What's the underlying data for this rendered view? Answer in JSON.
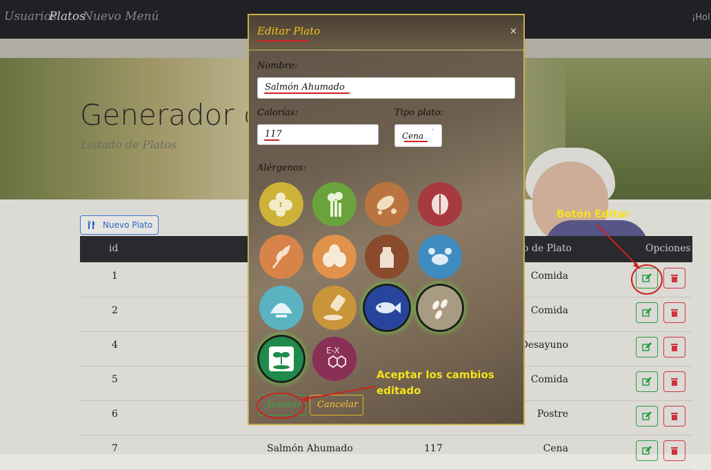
{
  "navbar": {
    "items": [
      "Usuarios",
      "Platos",
      "Nuevo Menú"
    ],
    "active": "Platos",
    "greeting": "¡Hol"
  },
  "hero": {
    "title": "Generador de",
    "subtitle": "Listado de Platos"
  },
  "toolbar": {
    "new_dish_label": "Nuevo Plato"
  },
  "table": {
    "headers": {
      "id": "id",
      "tipo": "o de Plato",
      "opciones": "Opciones"
    },
    "rows": [
      {
        "id": "1",
        "tipo": "Comida"
      },
      {
        "id": "2",
        "tipo": "Comida"
      },
      {
        "id": "4",
        "tipo": "Desayuno"
      },
      {
        "id": "5",
        "tipo": "Comida"
      },
      {
        "id": "6",
        "tipo": "Postre"
      },
      {
        "id": "7",
        "nombre": "Salmón Ahumado",
        "calorias": "117",
        "tipo": "Cena"
      }
    ]
  },
  "modal": {
    "title": "Editar Plato",
    "close": "×",
    "nombre_label": "Nombre:",
    "nombre_value": "Salmón Ahumado",
    "calorias_label": "Calorías:",
    "calorias_value": "117",
    "tipo_label": "Tipo plato:",
    "tipo_value": "Cena",
    "alergenos_label": "Alérgenos:",
    "allergens": [
      {
        "icon": "mustard-icon",
        "color": "#cdb23a",
        "selected": false
      },
      {
        "icon": "celery-icon",
        "color": "#6aa33c",
        "selected": false
      },
      {
        "icon": "peanut-icon",
        "color": "#b9743f",
        "selected": false
      },
      {
        "icon": "nuts-icon",
        "color": "#a73a3e",
        "selected": false
      },
      {
        "icon": "gluten-icon",
        "color": "#d8834a",
        "selected": false
      },
      {
        "icon": "eggs-icon",
        "color": "#e0914a",
        "selected": false
      },
      {
        "icon": "milk-icon",
        "color": "#8a4a2c",
        "selected": false
      },
      {
        "icon": "crustaceans-icon",
        "color": "#3f8cc0",
        "selected": false
      },
      {
        "icon": "molluscs-icon",
        "color": "#5bb3c2",
        "selected": false
      },
      {
        "icon": "soy-sauce-icon",
        "color": "#c9953a",
        "selected": false
      },
      {
        "icon": "fish-icon",
        "color": "#27459c",
        "selected": true
      },
      {
        "icon": "sesame-icon",
        "color": "#a99a82",
        "selected": true
      },
      {
        "icon": "lupin-icon",
        "color": "#1f8a4a",
        "selected": true
      },
      {
        "icon": "sulphites-icon",
        "color": "#8a2f55",
        "selected": false
      }
    ],
    "accept_label": "Aceptar",
    "cancel_label": "Cancelar"
  },
  "annotations": {
    "edit_button": "Botón Editar",
    "accept_line1": "Aceptar los cambios",
    "accept_line2": "editado"
  },
  "colors": {
    "accent_yellow": "#f5e31a",
    "annotation_red": "#d01e1e",
    "edit_green": "#28a745",
    "delete_red": "#dc3545"
  }
}
